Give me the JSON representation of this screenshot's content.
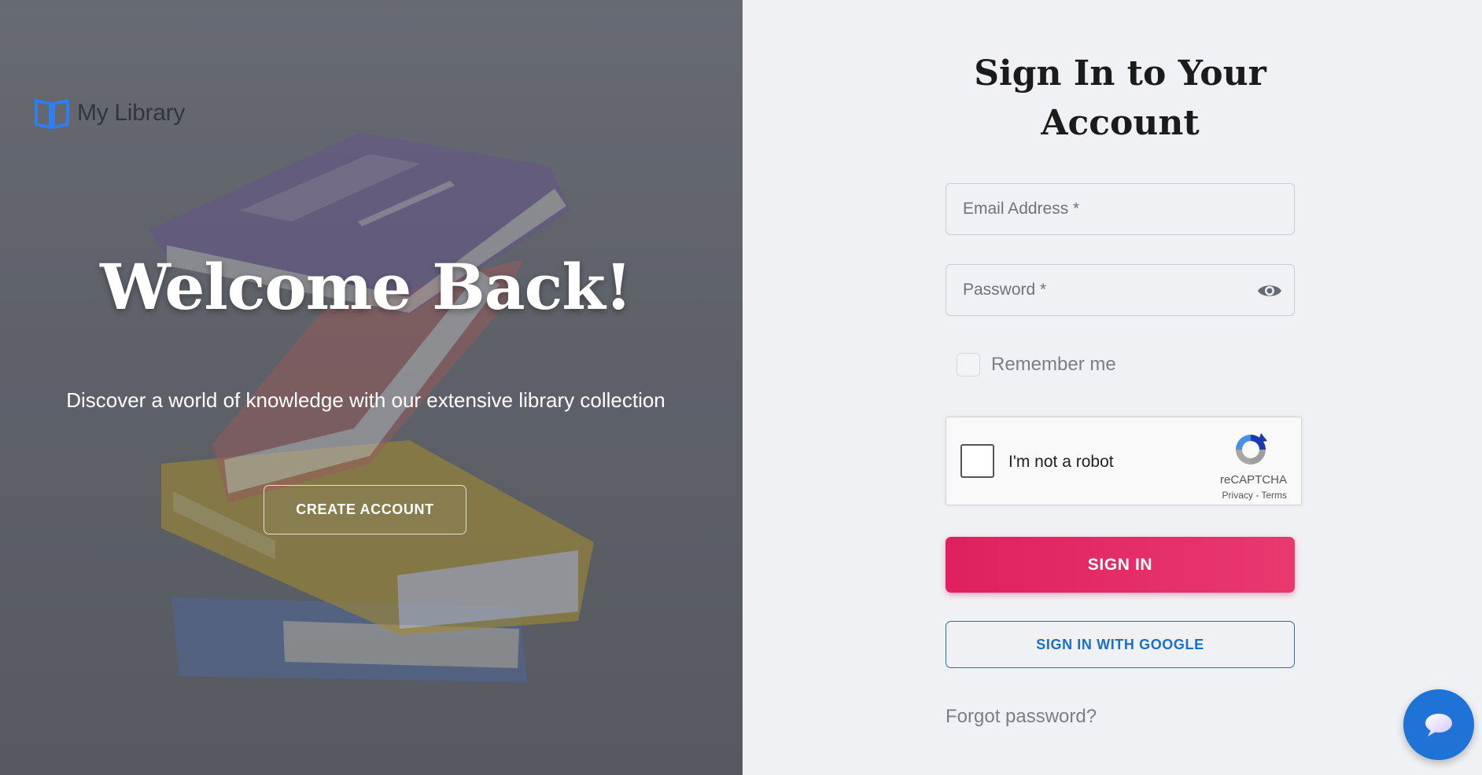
{
  "hero": {
    "logo_text": "My Library",
    "logo_icon": "open-book-icon",
    "title": "Welcome Back!",
    "subtitle": "Discover a world of knowledge with our extensive library collection",
    "create_account_label": "CREATE ACCOUNT"
  },
  "form": {
    "title_line1": "Sign In to Your",
    "title_line2": "Account",
    "email_placeholder": "Email Address *",
    "password_placeholder": "Password *",
    "remember_label": "Remember me",
    "recaptcha": {
      "label": "I'm not a robot",
      "brand": "reCAPTCHA",
      "privacy": "Privacy",
      "separator": " - ",
      "terms": "Terms"
    },
    "sign_in_label": "SIGN IN",
    "google_label": "SIGN IN WITH GOOGLE",
    "forgot_label": "Forgot password?"
  },
  "chat": {
    "icon": "chat-bubble-icon"
  },
  "colors": {
    "primary_pink": "#e0205f",
    "google_blue": "#1b6fc9",
    "chat_blue": "#1f73d6",
    "logo_blue": "#2f7df0"
  }
}
